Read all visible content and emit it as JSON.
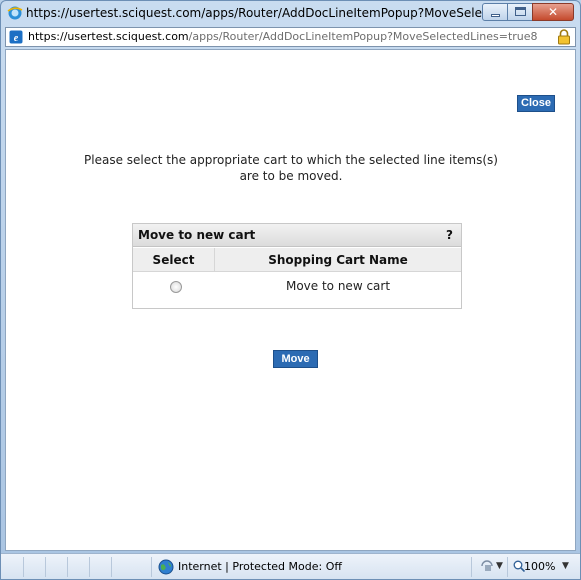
{
  "window": {
    "title": "https://usertest.sciquest.com/apps/Router/AddDocLineItemPopup?MoveSelect..."
  },
  "address": {
    "host": "https://usertest.sciquest.com",
    "path": "/apps/Router/AddDocLineItemPopup?MoveSelectedLines=true8"
  },
  "page": {
    "close_label": "Close",
    "instruction": "Please select the appropriate cart to which the selected line items(s) are to be moved.",
    "panel": {
      "title": "Move to new cart",
      "help": "?",
      "columns": [
        "Select",
        "Shopping Cart Name"
      ],
      "rows": [
        {
          "selected": false,
          "name": "Move to new cart"
        }
      ]
    },
    "move_label": "Move"
  },
  "status": {
    "zone": "Internet | Protected Mode: Off",
    "zoom": "100%"
  },
  "colors": {
    "button_blue": "#2c6bb3",
    "close_red": "#c44a2d"
  }
}
